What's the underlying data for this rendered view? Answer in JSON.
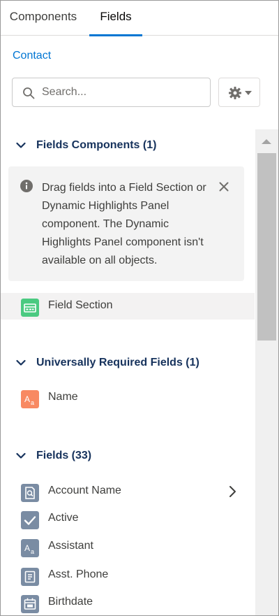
{
  "tabs": [
    {
      "label": "Components",
      "active": false
    },
    {
      "label": "Fields",
      "active": true
    }
  ],
  "object_link": "Contact",
  "search": {
    "placeholder": "Search...",
    "value": ""
  },
  "settings_button": {
    "icon": "gear-icon",
    "dropdown_icon": "caret-down-icon"
  },
  "sections": {
    "field_components": {
      "label": "Fields Components (1)"
    },
    "universally_required": {
      "label": "Universally Required Fields (1)"
    },
    "fields": {
      "label": "Fields (33)"
    }
  },
  "info": {
    "text": "Drag fields into a Field Section or Dynamic Highlights Panel component. The Dynamic Highlights Panel component isn't available on all objects.",
    "icon": "info-icon",
    "close_icon": "close-icon"
  },
  "component_items": [
    {
      "label": "Field Section",
      "icon": "field-section-icon",
      "color": "#4bca81"
    }
  ],
  "required_fields": [
    {
      "label": "Name",
      "icon": "text-field-icon",
      "color": "#f88962"
    }
  ],
  "fields": [
    {
      "label": "Account Name",
      "icon": "lookup-field-icon",
      "color": "#7f8de1"
    },
    {
      "label": "Active",
      "icon": "checkbox-field-icon",
      "color": "#7f8de1"
    },
    {
      "label": "Assistant",
      "icon": "text-field-icon",
      "color": "#7f8de1"
    },
    {
      "label": "Asst. Phone",
      "icon": "phone-field-icon",
      "color": "#7f8de1"
    },
    {
      "label": "Birthdate",
      "icon": "date-field-icon",
      "color": "#7f8de1"
    }
  ],
  "colors": {
    "accent": "#0176d3",
    "section_header": "#16325c",
    "icon_neutral": "#7a8ca3"
  }
}
